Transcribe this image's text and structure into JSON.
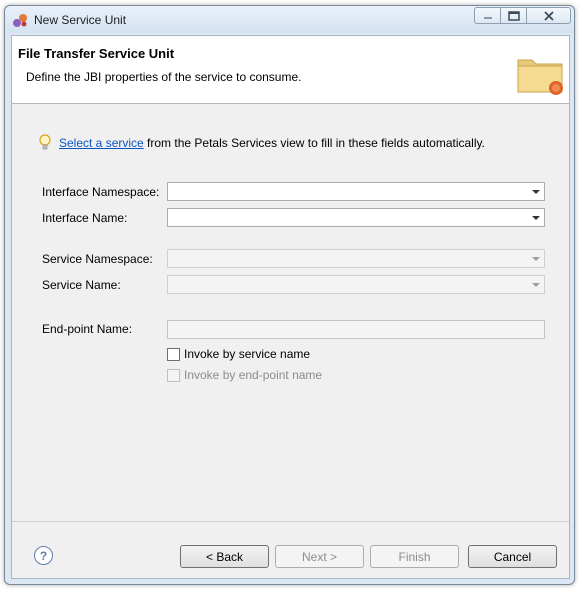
{
  "window": {
    "title": "New Service Unit"
  },
  "banner": {
    "title": "File Transfer Service Unit",
    "description": "Define the JBI properties of the service to consume."
  },
  "hint": {
    "link": "Select a service",
    "text": " from the Petals Services view to fill in these fields automatically."
  },
  "fields": {
    "interface_namespace": {
      "label": "Interface Namespace:",
      "value": ""
    },
    "interface_name": {
      "label": "Interface Name:",
      "value": ""
    },
    "service_namespace": {
      "label": "Service Namespace:",
      "value": ""
    },
    "service_name": {
      "label": "Service Name:",
      "value": ""
    },
    "endpoint_name": {
      "label": "End-point Name:",
      "value": ""
    }
  },
  "checkboxes": {
    "invoke_by_service": {
      "label": "Invoke by service name",
      "checked": false
    },
    "invoke_by_endpoint": {
      "label": "Invoke by end-point name",
      "checked": false
    }
  },
  "buttons": {
    "back": "< Back",
    "next": "Next >",
    "finish": "Finish",
    "cancel": "Cancel"
  },
  "icons": {
    "app": "petals-app-icon",
    "banner": "folder-icon",
    "hint": "lightbulb-icon",
    "help": "help-icon"
  }
}
